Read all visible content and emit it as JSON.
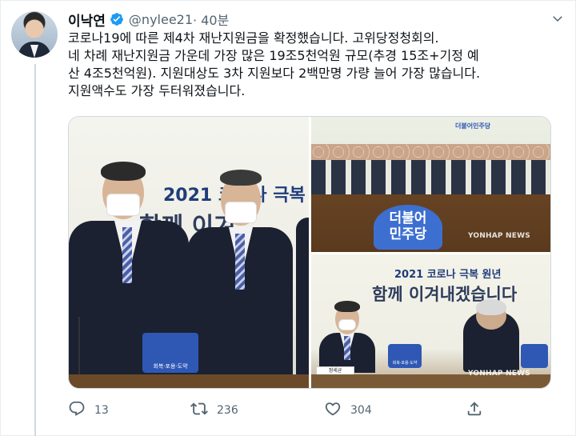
{
  "tweet": {
    "author_name": "이낙연",
    "handle": "@nylee21",
    "time": " · 40분",
    "text_lines": [
      "코로나19에 따른 제4차 재난지원금을 확정했습니다. 고위당정청회의.",
      "네 차례 재난지원금 가운데 가장 많은 19조5천억원 규모(추경 15조+기정 예",
      "산 4조5천억원). 지원대상도 3차 지원보다 2백만명 가량 늘어 가장 많습니다.",
      "지원액수도 가장 두터워졌습니다."
    ]
  },
  "media": {
    "left_banner": "2021 코로나 극복",
    "left_banner2": "함께 이겨",
    "left_plaque": "회복·포용·도약",
    "top_right_badge_line1": "더불어",
    "top_right_badge_line2": "민주당",
    "top_right_watermark": "YONHAP NEWS",
    "top_right_wall": "더불어민주당",
    "bottom_right_banner1": "2021 코로나 극복 원년",
    "bottom_right_banner2": "함께 이겨내겠습니다",
    "bottom_right_nameplate": "정세균",
    "bottom_right_plaque": "회복·포용·도약",
    "bottom_right_watermark": "YONHAP NEWS"
  },
  "actions": {
    "reply_count": "13",
    "retweet_count": "236",
    "like_count": "304"
  },
  "icons": {
    "verified": "verified-badge-icon",
    "more": "chevron-down-icon",
    "reply": "reply-icon",
    "retweet": "retweet-icon",
    "like": "heart-icon",
    "share": "share-icon"
  },
  "colors": {
    "verified_blue": "#1d9bf0",
    "secondary_text": "#536471"
  }
}
